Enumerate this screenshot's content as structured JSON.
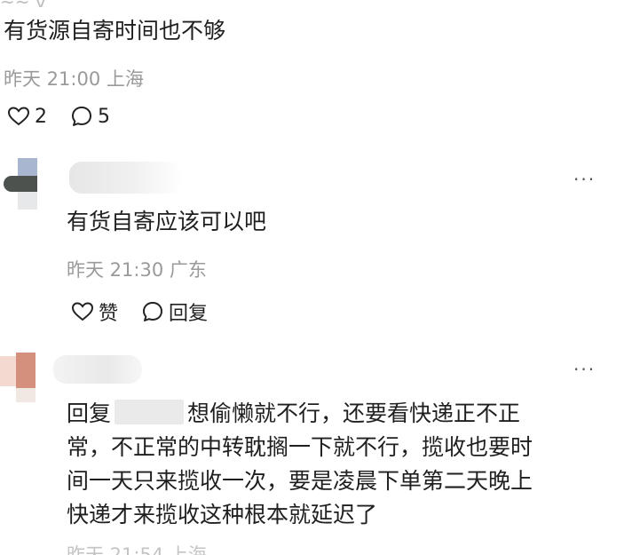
{
  "top_comment": {
    "text": "有货源自寄时间也不够",
    "time": "昨天 21:00",
    "location": "上海",
    "likes": "2",
    "replies": "5"
  },
  "reply1": {
    "text": "有货自寄应该可以吧",
    "time": "昨天 21:30",
    "location": "广东",
    "like_label": "赞",
    "reply_label": "回复",
    "more": "···"
  },
  "reply2": {
    "reply_prefix": "回复",
    "text_line1": "想偷懒就不行，还要看快递正不正",
    "text_line2": "常，不正常的中转耽搁一下就不行，揽收也要时",
    "text_line3": "间一天只来揽收一次，要是凌晨下单第二天晚上",
    "text_line4": "快递才来揽收这种根本就延迟了",
    "more": "···"
  },
  "colors": {
    "text": "#1f1f1f",
    "meta": "#9a9a9a",
    "icon": "#222222"
  }
}
